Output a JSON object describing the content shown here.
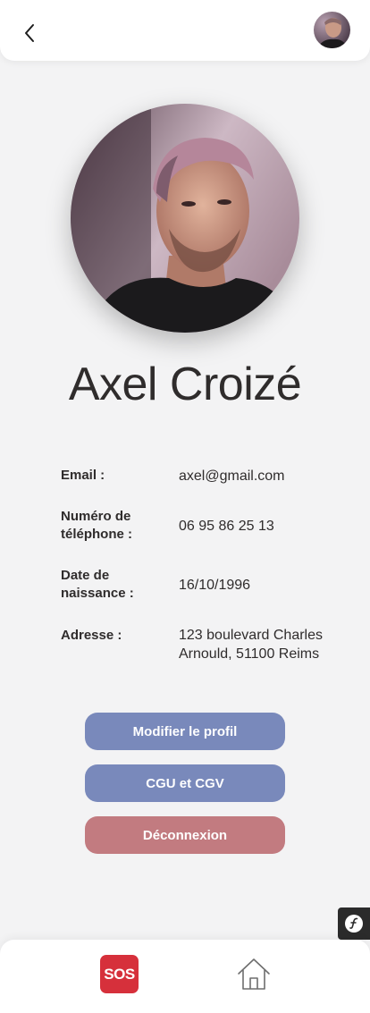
{
  "header": {
    "back_icon": "chevron-left-icon",
    "avatar_icon": "user-avatar"
  },
  "profile": {
    "name": "Axel Croizé"
  },
  "info": {
    "email_label": "Email :",
    "email_value": "axel@gmail.com",
    "phone_label": "Numéro de téléphone :",
    "phone_value": "06 95 86 25 13",
    "birth_label": "Date de naissance :",
    "birth_value": "16/10/1996",
    "address_label": "Adresse :",
    "address_value": "123 boulevard Charles Arnould, 51100 Reims"
  },
  "actions": {
    "edit_label": "Modifier le profil",
    "terms_label": "CGU et CGV",
    "logout_label": "Déconnexion"
  },
  "nav": {
    "sos_label": "SOS",
    "home_icon": "home-icon"
  },
  "colors": {
    "primary_button": "#7989bb",
    "logout_button": "#c27b80",
    "sos": "#d6303b",
    "background": "#f3f3f4"
  }
}
